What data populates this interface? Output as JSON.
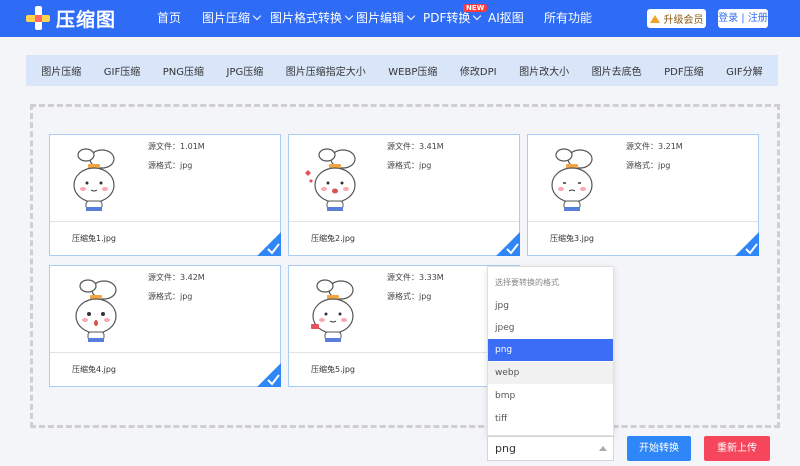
{
  "app": {
    "logo_text": "压缩图"
  },
  "nav": {
    "items": [
      {
        "label": "首页",
        "has_menu": false
      },
      {
        "label": "图片压缩",
        "has_menu": true
      },
      {
        "label": "图片格式转换",
        "has_menu": true
      },
      {
        "label": "图片编辑",
        "has_menu": true
      },
      {
        "label": "PDF转换",
        "has_menu": true
      },
      {
        "label": "AI抠图",
        "has_menu": false
      },
      {
        "label": "所有功能",
        "has_menu": false
      }
    ],
    "new_badge": "NEW",
    "upgrade_label": "升级会员",
    "login_label": "登录 | 注册"
  },
  "tools": [
    "图片压缩",
    "GIF压缩",
    "PNG压缩",
    "JPG压缩",
    "图片压缩指定大小",
    "WEBP压缩",
    "修改DPI",
    "图片改大小",
    "图片去底色",
    "PDF压缩",
    "GIF分解"
  ],
  "files": [
    {
      "name": "压缩兔1.jpg",
      "size": "源文件：1.01M",
      "format": "源格式：jpg",
      "checked": true
    },
    {
      "name": "压缩兔2.jpg",
      "size": "源文件：3.41M",
      "format": "源格式：jpg",
      "checked": true
    },
    {
      "name": "压缩兔3.jpg",
      "size": "源文件：3.21M",
      "format": "源格式：jpg",
      "checked": true
    },
    {
      "name": "压缩兔4.jpg",
      "size": "源文件：3.42M",
      "format": "源格式：jpg",
      "checked": true
    },
    {
      "name": "压缩兔5.jpg",
      "size": "源文件：3.33M",
      "format": "源格式：jpg",
      "checked": false
    }
  ],
  "format_dropdown": {
    "title": "选择要转换的格式",
    "options": [
      "jpg",
      "jpeg",
      "png",
      "webp",
      "bmp",
      "tiff"
    ],
    "selected": "png",
    "hovered": "webp"
  },
  "actions": {
    "selected_format": "png",
    "convert_label": "开始转换",
    "reupload_label": "重新上传"
  },
  "colors": {
    "brand": "#2f6cf6",
    "convert": "#2f86f6",
    "reupload": "#f6465c",
    "selected_option": "#3b6ef5"
  }
}
